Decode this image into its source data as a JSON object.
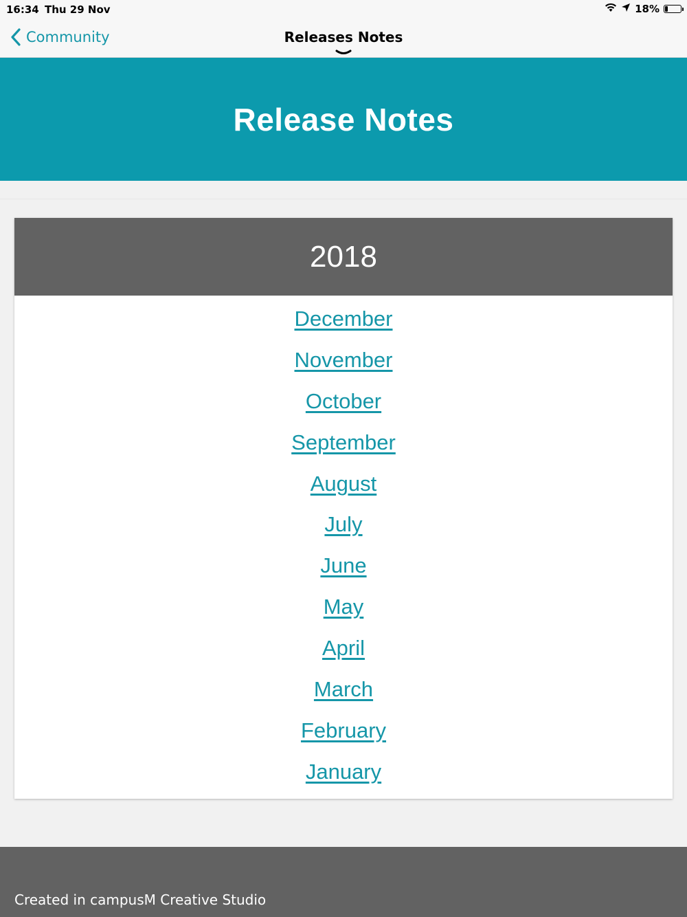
{
  "status_bar": {
    "time": "16:34",
    "date": "Thu 29 Nov",
    "battery": "18%",
    "battery_level": 0.18,
    "icons": [
      "wifi-icon",
      "location-arrow-icon",
      "battery-icon"
    ]
  },
  "nav": {
    "back_label": "Community",
    "title": "Releases Notes"
  },
  "banner": {
    "title": "Release Notes"
  },
  "card": {
    "year": "2018",
    "months": [
      {
        "label": "December"
      },
      {
        "label": "November"
      },
      {
        "label": "October"
      },
      {
        "label": "September"
      },
      {
        "label": "August"
      },
      {
        "label": "July"
      },
      {
        "label": "June"
      },
      {
        "label": "May"
      },
      {
        "label": "April"
      },
      {
        "label": "March"
      },
      {
        "label": "February"
      },
      {
        "label": "January"
      }
    ]
  },
  "footer": {
    "text": "Created in campusM Creative Studio"
  },
  "colors": {
    "accent": "#0c9aad",
    "link": "#1596a8",
    "header_gray": "#626262",
    "background": "#f1f1f1"
  }
}
